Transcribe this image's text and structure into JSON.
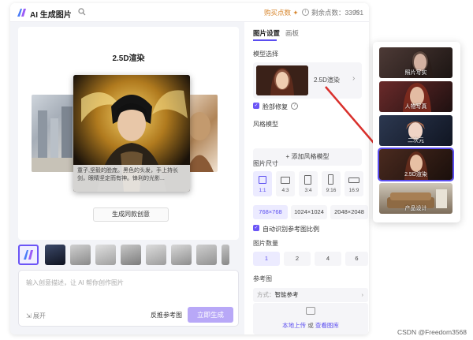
{
  "app": {
    "title": "AI 生成图片",
    "buy_points": "购买点数 ✦",
    "points_label": "剩余点数：33931",
    "close": "×"
  },
  "preview": {
    "title": "2.5D渲染",
    "caption": "童子,坚毅的脸庞。黑色的头发，手上持长剑，眼睛坚定而有神。锋利的光影...",
    "generate_same": "生成同款创意"
  },
  "thumbnails": [
    "ai-logo",
    "sphere",
    "helmet",
    "statue",
    "bust",
    "column",
    "bust2",
    "bust3",
    "face"
  ],
  "prompt": {
    "placeholder": "输入创意描述，让 AI 帮你创作图片",
    "expand": "⇲ 展开",
    "ref_image": "反推参考图",
    "generate": "立即生成"
  },
  "settings": {
    "tabs": [
      "图片设置",
      "画板"
    ],
    "model_label": "模型选择",
    "model_name": "2.5D渲染",
    "model_arrow": "›",
    "smart_fix": "脸部修复",
    "style_label": "风格模型",
    "style_add": "+ 添加风格模型",
    "size_label": "图片尺寸",
    "ratios": [
      {
        "label": "1:1",
        "w": 9,
        "h": 9,
        "active": true
      },
      {
        "label": "4:3",
        "w": 10,
        "h": 8,
        "active": false
      },
      {
        "label": "3:4",
        "w": 8,
        "h": 10,
        "active": false
      },
      {
        "label": "9:16",
        "w": 6,
        "h": 11,
        "active": false
      },
      {
        "label": "16:9",
        "w": 11,
        "h": 6,
        "active": false
      }
    ],
    "sizes": [
      {
        "label": "768×768",
        "active": true
      },
      {
        "label": "1024×1024",
        "active": false
      },
      {
        "label": "2048×2048",
        "active": false
      }
    ],
    "auto_ratio": "自动识别参考图比例",
    "count_label": "图片数量",
    "counts": [
      {
        "label": "1",
        "active": true
      },
      {
        "label": "2",
        "active": false
      },
      {
        "label": "4",
        "active": false
      },
      {
        "label": "6",
        "active": false
      }
    ],
    "ref_label": "参考图",
    "mode_prefix": "方式：",
    "mode_value": "智能参考",
    "mode_arrow": "›",
    "upload_local": "本地上传",
    "upload_or": " 或 ",
    "upload_gallery": "查看图库"
  },
  "gallery": {
    "items": [
      {
        "label": "照片写实",
        "selected": false
      },
      {
        "label": "人物写真",
        "selected": false
      },
      {
        "label": "二次元",
        "selected": false
      },
      {
        "label": "2.5D渲染",
        "selected": true
      },
      {
        "label": "产品设计",
        "selected": false
      }
    ]
  },
  "watermark": "CSDN @Freedom3568",
  "colors": {
    "accent": "#5a4df0",
    "arrow": "#d9302c",
    "buy": "#d7862d",
    "generate_btn": "#b8a8f7"
  }
}
